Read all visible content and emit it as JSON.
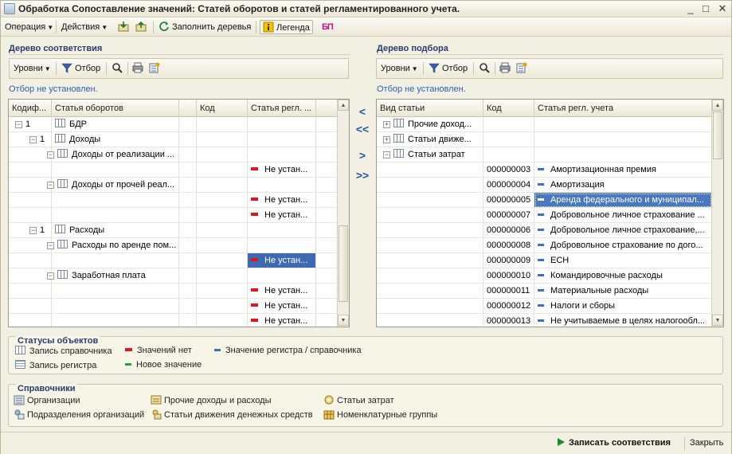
{
  "window": {
    "title": "Обработка  Сопоставление значений: Статей оборотов и статей регламентированного учета.",
    "buttons": [
      "_",
      "□",
      "✕"
    ]
  },
  "toolbar": {
    "operation": "Операция",
    "actions": "Действия",
    "fill_trees": "Заполнить деревья",
    "legend": "Легенда",
    "bp_label": "БП"
  },
  "left_panel": {
    "title": "Дерево соответствия",
    "levels": "Уровни",
    "filter": "Отбор",
    "filter_status": "Отбор не установлен.",
    "columns": [
      "Кодиф...",
      "Статья оборотов",
      "",
      "Код",
      "Статья регл. ..."
    ],
    "rows": [
      {
        "kod": "1",
        "article": "БДР",
        "code": "",
        "regl": "",
        "level": 0,
        "toggle": "−",
        "marker": ""
      },
      {
        "kod": "1",
        "article": "Доходы",
        "code": "",
        "regl": "",
        "level": 1,
        "toggle": "−",
        "marker": ""
      },
      {
        "kod": "",
        "article": "Доходы от реализации ...",
        "code": "",
        "regl": "",
        "level": 2,
        "toggle": "−",
        "marker": ""
      },
      {
        "kod": "",
        "article": "",
        "code": "",
        "regl": "Не устан...",
        "level": 3,
        "toggle": "",
        "marker": "red"
      },
      {
        "kod": "",
        "article": "Доходы от прочей реал...",
        "code": "",
        "regl": "",
        "level": 2,
        "toggle": "−",
        "marker": ""
      },
      {
        "kod": "",
        "article": "",
        "code": "",
        "regl": "Не устан...",
        "level": 3,
        "toggle": "",
        "marker": "red"
      },
      {
        "kod": "",
        "article": "",
        "code": "",
        "regl": "Не устан...",
        "level": 3,
        "toggle": "",
        "marker": "red"
      },
      {
        "kod": "1",
        "article": "Расходы",
        "code": "",
        "regl": "",
        "level": 1,
        "toggle": "−",
        "marker": ""
      },
      {
        "kod": "",
        "article": "Расходы по аренде пом...",
        "code": "",
        "regl": "",
        "level": 2,
        "toggle": "−",
        "marker": ""
      },
      {
        "kod": "",
        "article": "",
        "code": "",
        "regl": "Не устан...",
        "level": 3,
        "toggle": "",
        "marker": "red",
        "selected": true
      },
      {
        "kod": "",
        "article": "Заработная плата",
        "code": "",
        "regl": "",
        "level": 2,
        "toggle": "−",
        "marker": ""
      },
      {
        "kod": "",
        "article": "",
        "code": "",
        "regl": "Не устан...",
        "level": 3,
        "toggle": "",
        "marker": "red"
      },
      {
        "kod": "",
        "article": "",
        "code": "",
        "regl": "Не устан...",
        "level": 3,
        "toggle": "",
        "marker": "red"
      },
      {
        "kod": "",
        "article": "",
        "code": "",
        "regl": "Не устан...",
        "level": 3,
        "toggle": "",
        "marker": "red"
      }
    ]
  },
  "right_panel": {
    "title": "Дерево подбора",
    "levels": "Уровни",
    "filter": "Отбор",
    "filter_status": "Отбор не установлен.",
    "columns": [
      "Вид статьи",
      "Код",
      "Статья регл. учета"
    ],
    "rows": [
      {
        "kind": "Прочие доход...",
        "code": "",
        "article": "",
        "toggle": "+",
        "marker": ""
      },
      {
        "kind": "Статьи движе...",
        "code": "",
        "article": "",
        "toggle": "+",
        "marker": ""
      },
      {
        "kind": "Статьи затрат",
        "code": "",
        "article": "",
        "toggle": "−",
        "marker": ""
      },
      {
        "kind": "",
        "code": "000000003",
        "article": "Амортизационная премия",
        "toggle": "",
        "marker": "blue"
      },
      {
        "kind": "",
        "code": "000000004",
        "article": "Амортизация",
        "toggle": "",
        "marker": "blue"
      },
      {
        "kind": "",
        "code": "000000005",
        "article": "Аренда федерального и муниципал...",
        "toggle": "",
        "marker": "blue",
        "selected": true
      },
      {
        "kind": "",
        "code": "000000007",
        "article": "Добровольное личное страхование ...",
        "toggle": "",
        "marker": "blue"
      },
      {
        "kind": "",
        "code": "000000006",
        "article": "Добровольное личное страхование,...",
        "toggle": "",
        "marker": "blue"
      },
      {
        "kind": "",
        "code": "000000008",
        "article": "Добровольное страхование по дого...",
        "toggle": "",
        "marker": "blue"
      },
      {
        "kind": "",
        "code": "000000009",
        "article": "ЕСН",
        "toggle": "",
        "marker": "blue"
      },
      {
        "kind": "",
        "code": "000000010",
        "article": "Командировочные расходы",
        "toggle": "",
        "marker": "blue"
      },
      {
        "kind": "",
        "code": "000000011",
        "article": "Материальные расходы",
        "toggle": "",
        "marker": "blue"
      },
      {
        "kind": "",
        "code": "000000012",
        "article": "Налоги и сборы",
        "toggle": "",
        "marker": "blue"
      },
      {
        "kind": "",
        "code": "000000013",
        "article": "Не учитываемые в целях налогообл...",
        "toggle": "",
        "marker": "blue"
      }
    ]
  },
  "move_buttons": [
    "<",
    "<<",
    ">",
    ">>"
  ],
  "statuses": {
    "title": "Статусы объектов",
    "items": {
      "ref_record": "Запись справочника",
      "no_values": "Значений нет",
      "reg_value": "Значение регистра / справочника",
      "reg_record": "Запись регистра",
      "new_value": "Новое значение"
    }
  },
  "references": {
    "title": "Справочники",
    "items": {
      "orgs": "Организации",
      "other_income": "Прочие доходы и расходы",
      "cost_items": "Статьи затрат",
      "org_units": "Подразделения организаций",
      "cash_flow": "Статьи движения денежных средств",
      "nomenclature": "Номенклатурные группы"
    }
  },
  "footer": {
    "save": "Записать соответствия",
    "close": "Закрыть"
  },
  "colors": {
    "accent": "#2a3c6e",
    "link": "#2c5fb7",
    "no_value": "#e0161e",
    "reg_value": "#3b6fc8",
    "new_value": "#29a33c",
    "selection": "#3d6ab3"
  }
}
